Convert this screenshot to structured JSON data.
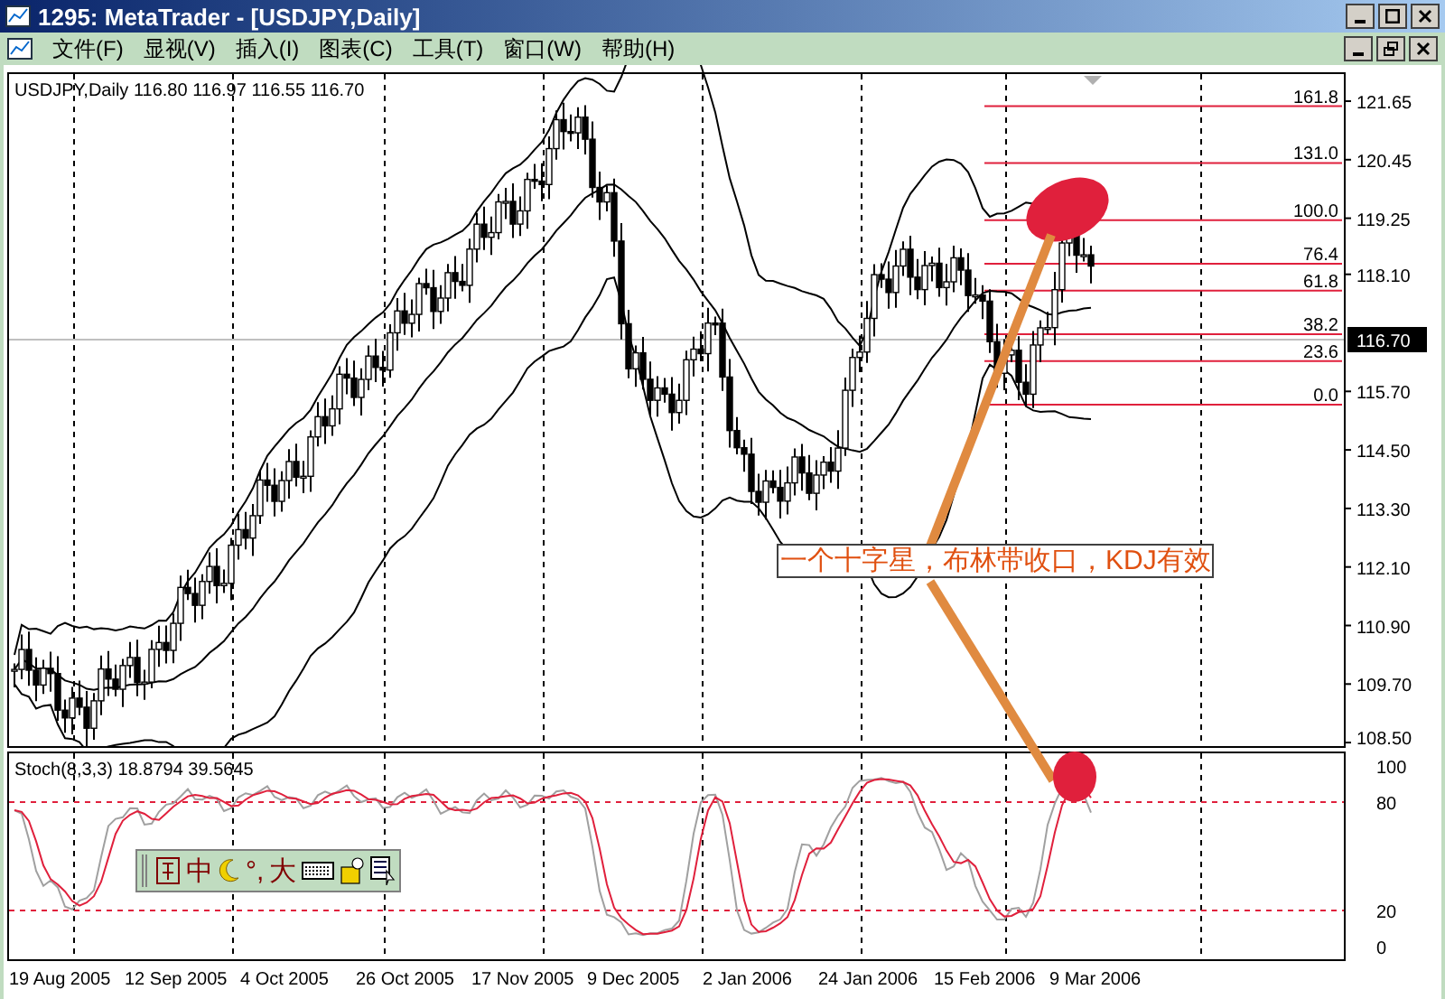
{
  "window": {
    "title": "1295: MetaTrader - [USDJPY,Daily]"
  },
  "menu": [
    {
      "label": "文件(F)"
    },
    {
      "label": "显视(V)"
    },
    {
      "label": "插入(I)"
    },
    {
      "label": "图表(C)"
    },
    {
      "label": "工具(T)"
    },
    {
      "label": "窗口(W)"
    },
    {
      "label": "帮助(H)"
    }
  ],
  "chart": {
    "header": "USDJPY,Daily  116.80 116.97 116.55 116.70",
    "price_labels": [
      "121.65",
      "120.45",
      "119.25",
      "118.10",
      "115.70",
      "114.50",
      "113.30",
      "112.10",
      "110.90",
      "109.70",
      "108.50"
    ],
    "current_price": "116.70",
    "fib_levels": [
      "161.8",
      "131.0",
      "100.0",
      "76.4",
      "61.8",
      "38.2",
      "23.6",
      "0.0"
    ],
    "annotation": "一个十字星，布林带收口，KDJ有效"
  },
  "stoch": {
    "header": "Stoch(8,3,3) 18.8794 39.5645",
    "levels": [
      "100",
      "80",
      "20",
      "0"
    ]
  },
  "dates": [
    "19 Aug 2005",
    "12 Sep 2005",
    "4 Oct 2005",
    "26 Oct 2005",
    "17 Nov 2005",
    "9 Dec 2005",
    "2 Jan 2006",
    "24 Jan 2006",
    "15 Feb 2006",
    "9 Mar 2006"
  ],
  "ime_toolbar": {
    "items": [
      "中",
      "°,",
      "大"
    ]
  }
}
